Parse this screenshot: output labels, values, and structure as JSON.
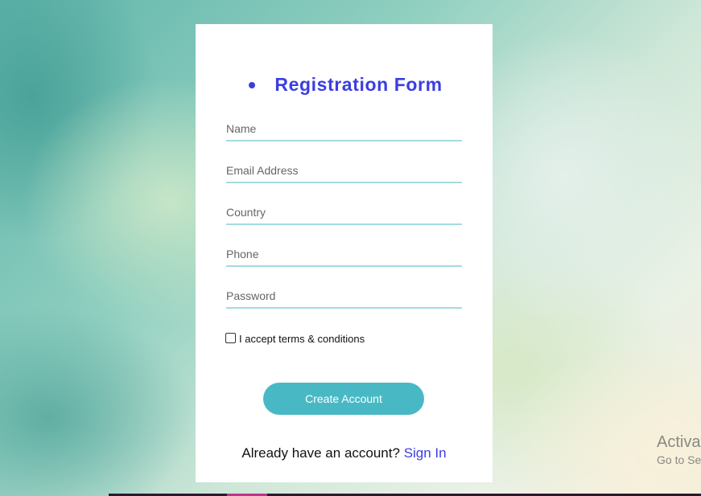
{
  "form": {
    "title": "Registration Form",
    "fields": {
      "name": {
        "placeholder": "Name",
        "value": ""
      },
      "email": {
        "placeholder": "Email Address",
        "value": ""
      },
      "country": {
        "placeholder": "Country",
        "value": ""
      },
      "phone": {
        "placeholder": "Phone",
        "value": ""
      },
      "password": {
        "placeholder": "Password",
        "value": ""
      }
    },
    "terms_label": "I accept terms & conditions",
    "terms_checked": false,
    "submit_label": "Create Account",
    "signin_prompt": "Already have an account?",
    "signin_link": "Sign In"
  },
  "windows_watermark": {
    "title": "Activat",
    "subtitle": "Go to Se"
  },
  "colors": {
    "accent": "#3b3ee0",
    "button": "#48b9c4",
    "field_underline": "#a3dbe0"
  }
}
